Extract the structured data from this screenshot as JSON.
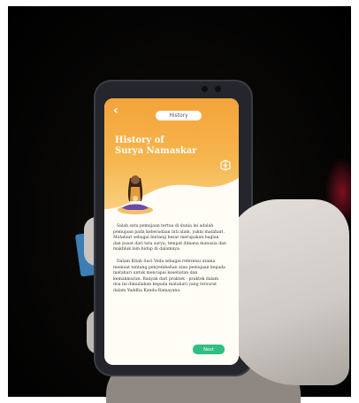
{
  "app": {
    "header": {
      "pill_label": "History",
      "title_line1": "History of",
      "title_line2": "Surya Namaskar"
    },
    "body": {
      "paragraph1": "Salah satu pemujaan tertua di dunia ini adalah pemujaan pada keberadaan inti alam, yakni matahari. Matahari sebagai bintang besar merupakan bagian dan pusat dari tata surya, tempat dimana manusia dan makhluk lain hidup di dalamnya.",
      "paragraph2": "Dalam Kitab Suci Veda sebagai referensi utama memuat tentang penyembahan atau pemujaan kepada matahari untuk mencapai kesehatan dan kemakmuran. Banyak dari praktek - praktek dalam doa ini dimuliakan kepada matahari yang tersurat dalam Yuddha Kanda-Ramayana."
    },
    "next_label": "Next"
  },
  "colors": {
    "accent_orange": "#f4a33a",
    "button_green": "#2fbf82",
    "screen_bg": "#fffdf6"
  },
  "icons": [
    "back-arrow-icon",
    "chevron-right-icon",
    "book-icon",
    "meditating-woman-illustration"
  ]
}
